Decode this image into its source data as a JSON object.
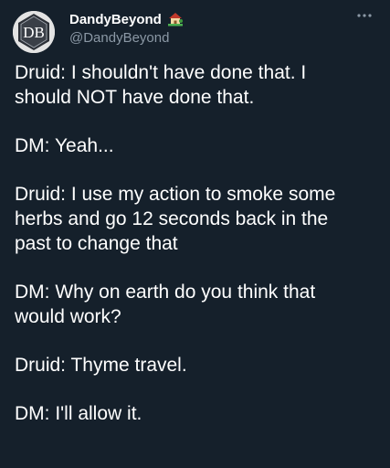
{
  "account": {
    "display_name": "DandyBeyond",
    "handle": "@DandyBeyond",
    "avatar_icon": "dndbeyond-logo",
    "badge_icon": "house-with-garden-icon",
    "avatar_monogram": "DB"
  },
  "menu": {
    "more_icon": "more-dots-icon"
  },
  "tweet": {
    "paragraphs": [
      "Druid: I shouldn't have done that. I\nshould NOT have done that.",
      "DM: Yeah...",
      "Druid: I use my action to smoke some\nherbs and go 12 seconds back in the\npast to change that",
      "DM: Why on earth do you think that\nwould work?",
      "Druid: Thyme travel.",
      "DM: I'll allow it."
    ]
  },
  "colors": {
    "background": "#15202b",
    "text": "#ffffff",
    "secondary_text": "#8b98a5"
  }
}
